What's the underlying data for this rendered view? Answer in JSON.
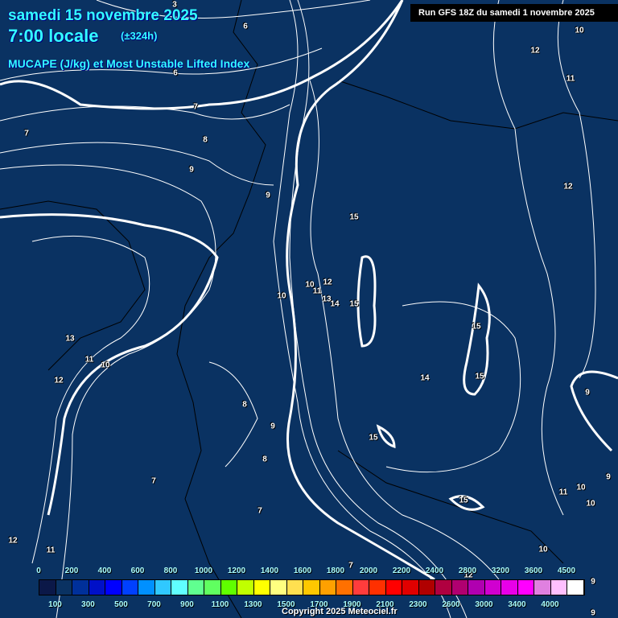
{
  "header": {
    "date": "samedi 15 novembre 2025",
    "time": "7:00 locale",
    "lead": "(±324h)",
    "parameter": "MUCAPE (J/kg) et Most Unstable Lifted Index",
    "run": "Run GFS 18Z du samedi 1 novembre 2025"
  },
  "legend": {
    "top_labels": [
      "0",
      "200",
      "400",
      "600",
      "800",
      "1000",
      "1200",
      "1400",
      "1600",
      "1800",
      "2000",
      "2200",
      "2400",
      "2800",
      "3200",
      "3600",
      "4500"
    ],
    "bottom_labels": [
      "100",
      "300",
      "500",
      "700",
      "900",
      "1100",
      "1300",
      "1500",
      "1700",
      "1900",
      "2100",
      "2300",
      "2600",
      "3000",
      "3400",
      "4000"
    ],
    "colors": [
      "#0b1848",
      "#0a3262",
      "#00309a",
      "#0010c8",
      "#0000ff",
      "#0040ff",
      "#0090ff",
      "#30c8ff",
      "#60ffff",
      "#60ff90",
      "#60ff60",
      "#60ff00",
      "#c0ff00",
      "#ffff00",
      "#ffff80",
      "#ffe050",
      "#ffc800",
      "#ffa000",
      "#ff7000",
      "#ff3c3c",
      "#ff3000",
      "#ff0000",
      "#e00000",
      "#b00000",
      "#b00040",
      "#b00070",
      "#b000b0",
      "#d000d0",
      "#e800e8",
      "#ff00ff",
      "#e080e0",
      "#ffc0ff",
      "#ffffff"
    ]
  },
  "contour_labels": [
    "3",
    "6",
    "6",
    "7",
    "7",
    "8",
    "9",
    "9",
    "15",
    "10",
    "12",
    "11",
    "10",
    "13",
    "14",
    "15",
    "15",
    "15",
    "14",
    "13",
    "11",
    "10",
    "12",
    "8",
    "9",
    "8",
    "15",
    "7",
    "7",
    "15",
    "11",
    "10",
    "10",
    "9",
    "9",
    "12",
    "11",
    "10",
    "10",
    "12",
    "11",
    "12",
    "9",
    "9",
    "12",
    "7"
  ],
  "copyright": "Copyright 2025 Meteociel.fr",
  "colors": {
    "background": "#0a3262",
    "title": "#33ffff",
    "contour": "#ffffff"
  }
}
